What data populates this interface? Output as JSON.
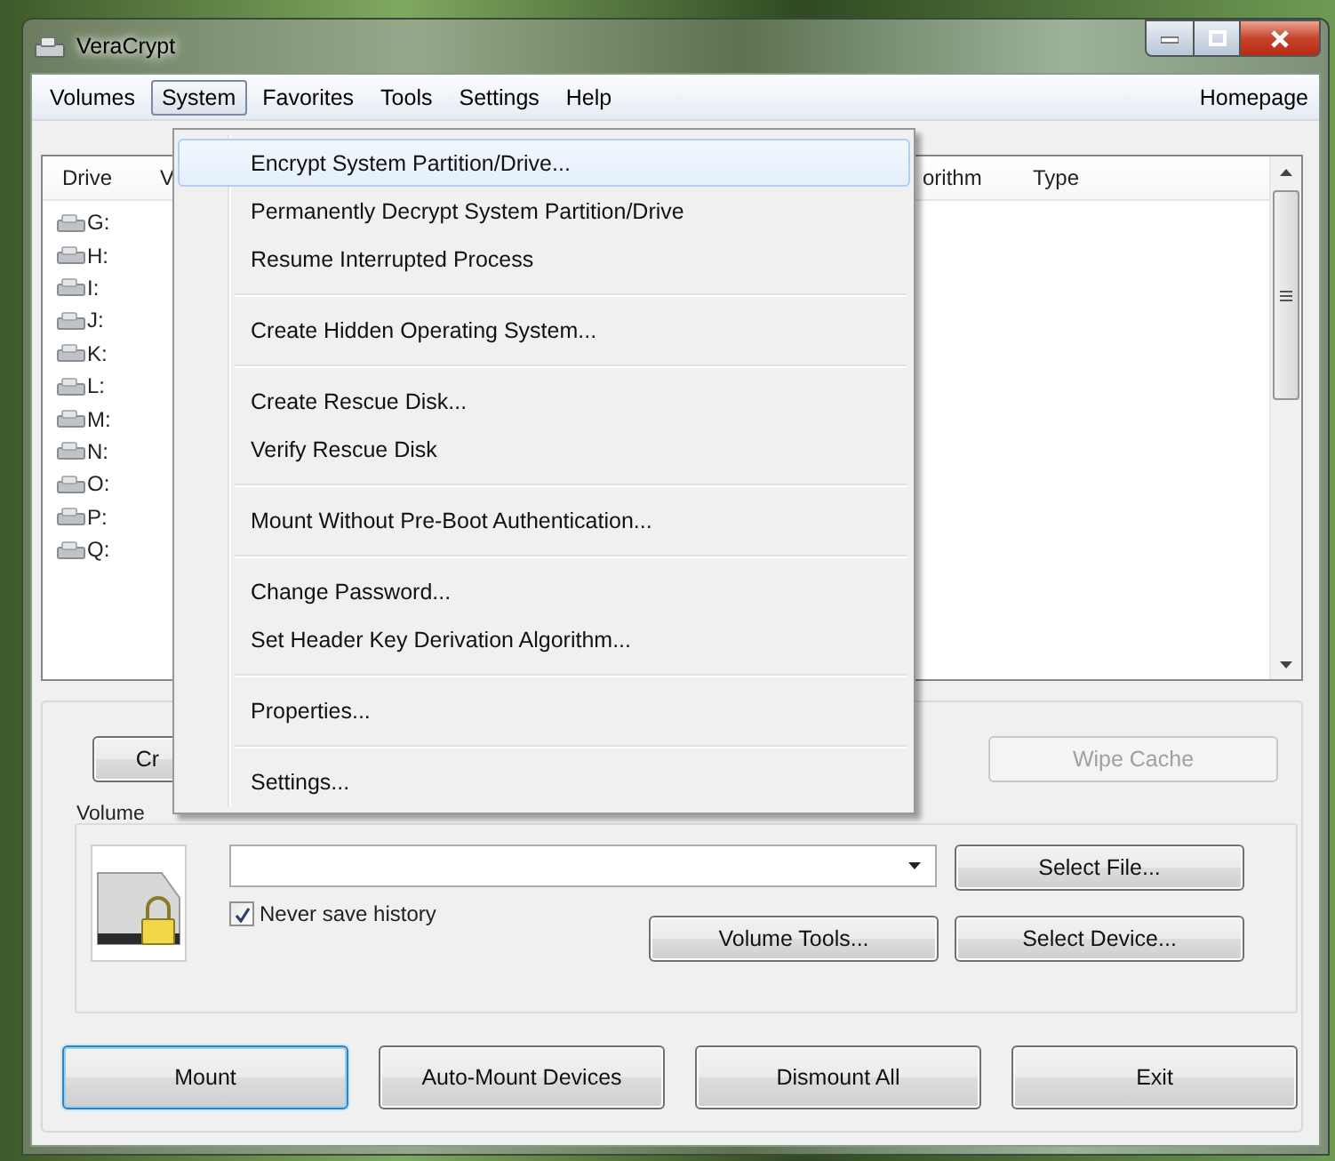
{
  "window": {
    "title": "VeraCrypt"
  },
  "menubar": {
    "items": [
      {
        "label": "Volumes",
        "selected": false
      },
      {
        "label": "System",
        "selected": true
      },
      {
        "label": "Favorites",
        "selected": false
      },
      {
        "label": "Tools",
        "selected": false
      },
      {
        "label": "Settings",
        "selected": false
      },
      {
        "label": "Help",
        "selected": false
      }
    ],
    "homepage": "Homepage"
  },
  "system_menu": {
    "groups": [
      [
        {
          "label": "Encrypt System Partition/Drive...",
          "selected": true
        },
        {
          "label": "Permanently Decrypt System Partition/Drive",
          "selected": false
        },
        {
          "label": "Resume Interrupted Process",
          "selected": false
        }
      ],
      [
        {
          "label": "Create Hidden Operating System...",
          "selected": false
        }
      ],
      [
        {
          "label": "Create Rescue Disk...",
          "selected": false
        },
        {
          "label": "Verify Rescue Disk",
          "selected": false
        }
      ],
      [
        {
          "label": "Mount Without Pre-Boot Authentication...",
          "selected": false
        }
      ],
      [
        {
          "label": "Change Password...",
          "selected": false
        },
        {
          "label": "Set Header Key Derivation Algorithm...",
          "selected": false
        }
      ],
      [
        {
          "label": "Properties...",
          "selected": false
        }
      ],
      [
        {
          "label": "Settings...",
          "selected": false
        }
      ]
    ]
  },
  "drive_list": {
    "columns": [
      "Drive",
      "V",
      "orithm",
      "Type"
    ],
    "rows": [
      {
        "drive": "G:"
      },
      {
        "drive": "H:"
      },
      {
        "drive": "I:"
      },
      {
        "drive": "J:"
      },
      {
        "drive": "K:"
      },
      {
        "drive": "L:"
      },
      {
        "drive": "M:"
      },
      {
        "drive": "N:"
      },
      {
        "drive": "O:"
      },
      {
        "drive": "P:"
      },
      {
        "drive": "Q:"
      }
    ]
  },
  "top_buttons": [
    {
      "label": "Cr",
      "disabled": false
    },
    {
      "label": "Wipe Cache",
      "disabled": true
    }
  ],
  "volume": {
    "label": "Volume",
    "never_save_history": {
      "label": "Never save history",
      "checked": true
    },
    "select_file": {
      "label": "Select File...",
      "disabled": false
    },
    "volume_tools": {
      "label": "Volume Tools...",
      "disabled": false
    },
    "select_device": {
      "label": "Select Device...",
      "disabled": false
    }
  },
  "actions": [
    {
      "label": "Mount",
      "default": true
    },
    {
      "label": "Auto-Mount Devices",
      "default": false
    },
    {
      "label": "Dismount All",
      "default": false
    },
    {
      "label": "Exit",
      "default": false
    }
  ]
}
